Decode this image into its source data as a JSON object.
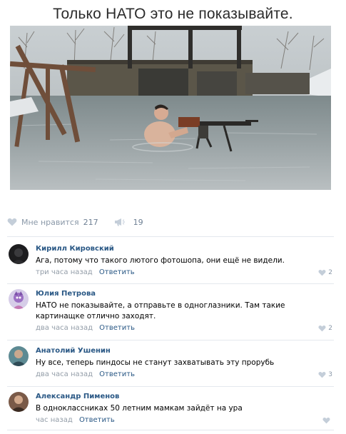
{
  "post": {
    "title": "Только НАТО это не показывайте."
  },
  "actions": {
    "like_label": "Мне нравится",
    "like_count": "217",
    "share_count": "19"
  },
  "comments": [
    {
      "author": "Кирилл Кировский",
      "text": "Ага, потому что такого лютого фотошопа, они ещё не видели.",
      "time": "три часа назад",
      "reply": "Ответить",
      "likes": "2"
    },
    {
      "author": "Юлия Петрова",
      "text": "НАТО не показывайте, а отправьте в одноглазники. Там такие картинащке отлично заходят.",
      "time": "два часа назад",
      "reply": "Ответить",
      "likes": "2"
    },
    {
      "author": "Анатолий Ушенин",
      "text": "Ну все, теперь пиндосы не станут захватывать эту прорубь",
      "time": "два часа назад",
      "reply": "Ответить",
      "likes": "3"
    },
    {
      "author": "Александр Пименов",
      "text": "В одноклассниках 50 летним мамкам зайдёт на ура",
      "time": "час назад",
      "reply": "Ответить",
      "likes": ""
    }
  ]
}
